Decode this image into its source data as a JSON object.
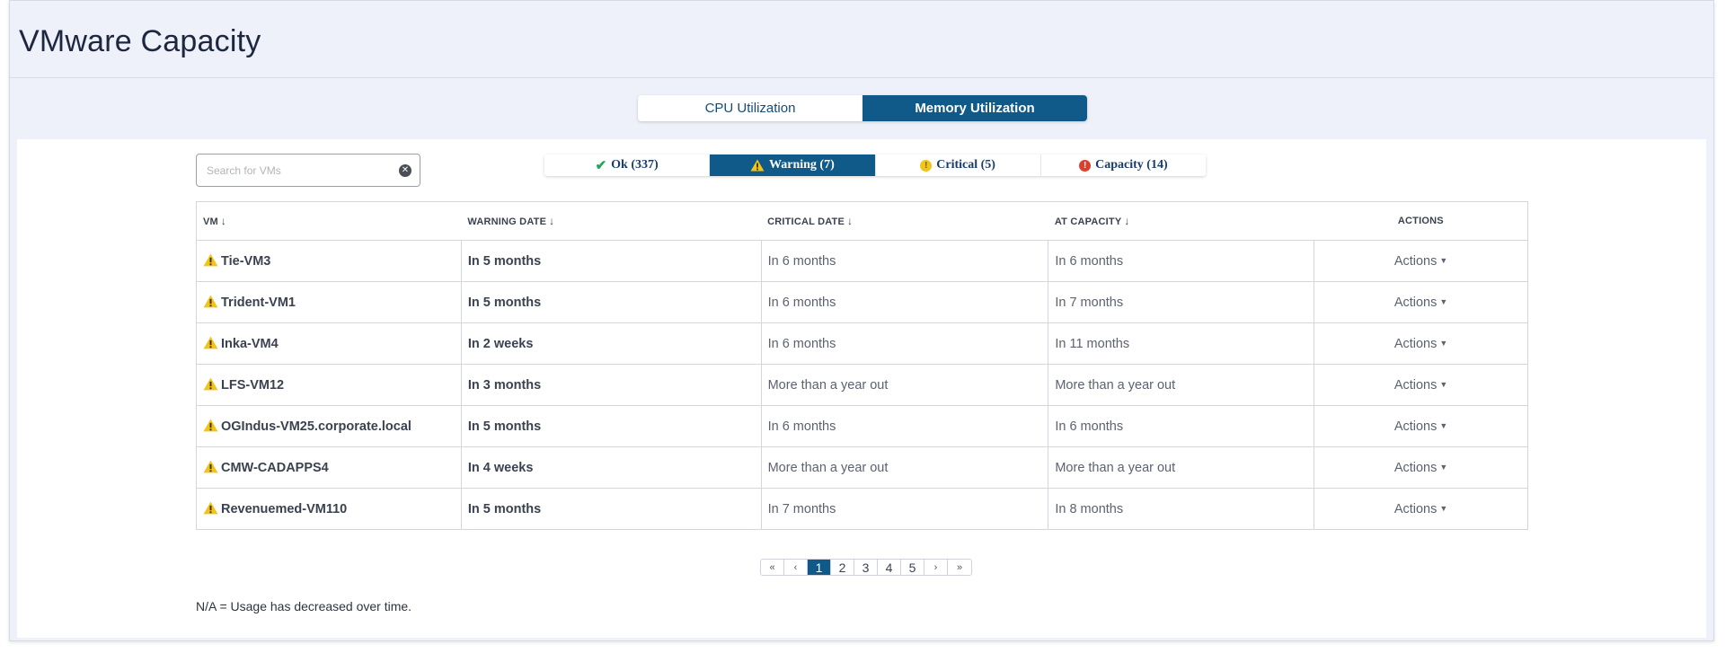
{
  "page": {
    "title": "VMware Capacity"
  },
  "utilization_tabs": [
    {
      "label": "CPU Utilization",
      "active": false
    },
    {
      "label": "Memory Utilization",
      "active": true
    }
  ],
  "search": {
    "placeholder": "Search for VMs",
    "value": ""
  },
  "status_tabs": [
    {
      "label": "Ok (337)",
      "icon": "check-icon",
      "active": false
    },
    {
      "label": "Warning (7)",
      "icon": "warning-icon",
      "active": true
    },
    {
      "label": "Critical (5)",
      "icon": "critical-icon",
      "active": false
    },
    {
      "label": "Capacity (14)",
      "icon": "capacity-icon",
      "active": false
    }
  ],
  "table": {
    "headers": {
      "vm": "VM",
      "warning_date": "WARNING DATE",
      "critical_date": "CRITICAL DATE",
      "at_capacity": "AT CAPACITY",
      "actions": "ACTIONS"
    },
    "rows": [
      {
        "vm": "Tie-VM3",
        "warning_date": "In 5 months",
        "critical_date": "In 6 months",
        "at_capacity": "In 6 months",
        "actions": "Actions"
      },
      {
        "vm": "Trident-VM1",
        "warning_date": "In 5 months",
        "critical_date": "In 6 months",
        "at_capacity": "In 7 months",
        "actions": "Actions"
      },
      {
        "vm": "Inka-VM4",
        "warning_date": "In 2 weeks",
        "critical_date": "In 6 months",
        "at_capacity": "In 11 months",
        "actions": "Actions"
      },
      {
        "vm": "LFS-VM12",
        "warning_date": "In 3 months",
        "critical_date": "More than a year out",
        "at_capacity": "More than a year out",
        "actions": "Actions"
      },
      {
        "vm": "OGIndus-VM25.corporate.local",
        "warning_date": "In 5 months",
        "critical_date": "In 6 months",
        "at_capacity": "In 6 months",
        "actions": "Actions"
      },
      {
        "vm": "CMW-CADAPPS4",
        "warning_date": "In 4 weeks",
        "critical_date": "More than a year out",
        "at_capacity": "More than a year out",
        "actions": "Actions"
      },
      {
        "vm": "Revenuemed-VM110",
        "warning_date": "In 5 months",
        "critical_date": "In 7 months",
        "at_capacity": "In 8 months",
        "actions": "Actions"
      }
    ]
  },
  "pagination": {
    "first": "«",
    "prev": "‹",
    "next": "›",
    "last": "»",
    "pages": [
      "1",
      "2",
      "3",
      "4",
      "5"
    ],
    "current": "1"
  },
  "footnote": "N/A = Usage has decreased over time.",
  "colors": {
    "primary": "#0f5a88",
    "warning": "#f2c318",
    "ok": "#23a55a",
    "critical": "#f0c419",
    "capacity": "#d9412e"
  }
}
